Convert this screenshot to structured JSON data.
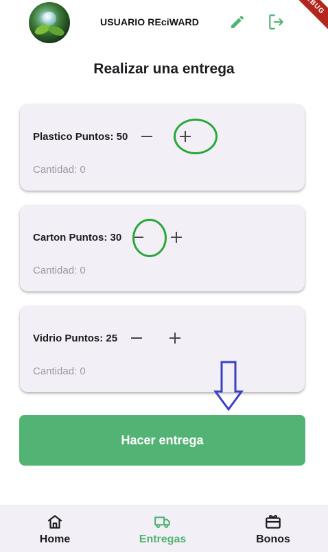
{
  "header": {
    "username": "USUARIO REciWARD",
    "debug_banner": "DEBUG",
    "icons": {
      "edit": "pencil-icon",
      "logout": "logout-icon",
      "avatar": "nature-avatar"
    }
  },
  "page": {
    "title": "Realizar una entrega"
  },
  "materials": [
    {
      "label": "Plastico Puntos: 50",
      "quantity": "Cantidad: 0"
    },
    {
      "label": "Carton Puntos: 30",
      "quantity": "Cantidad: 0"
    },
    {
      "label": "Vidrio Puntos: 25",
      "quantity": "Cantidad: 0"
    }
  ],
  "actions": {
    "submit_label": "Hacer entrega"
  },
  "nav": {
    "items": [
      {
        "label": "Home",
        "icon": "home-icon",
        "active": false
      },
      {
        "label": "Entregas",
        "icon": "truck-icon",
        "active": true
      },
      {
        "label": "Bonos",
        "icon": "gift-card-icon",
        "active": false
      }
    ]
  },
  "colors": {
    "accent": "#52b374",
    "card_bg": "#f3eff6",
    "annotation_green": "#27a83a",
    "annotation_blue": "#3a3fc4",
    "debug_red": "#b3261e"
  }
}
